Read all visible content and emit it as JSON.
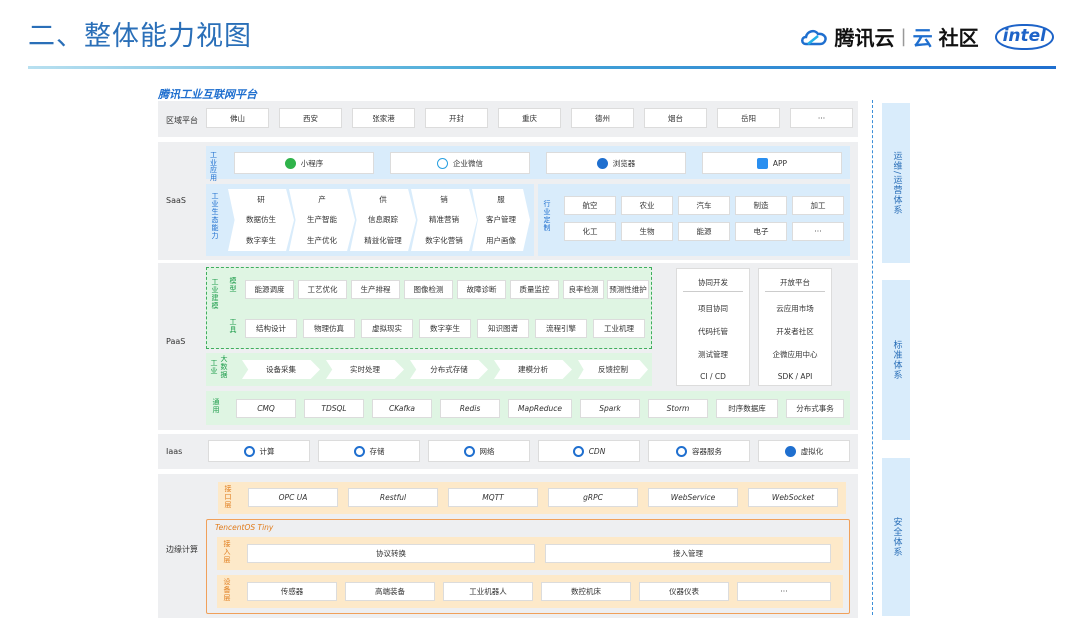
{
  "header": {
    "title": "二、整体能力视图",
    "brand_name": "腾讯云",
    "brand_sep": "|",
    "brand_yun": "云",
    "brand_community": "社区",
    "intel": "intel"
  },
  "platform_title": "腾讯工业互联网平台",
  "region": {
    "label": "区域平台",
    "items": [
      "佛山",
      "西安",
      "张家港",
      "开封",
      "重庆",
      "德州",
      "烟台",
      "岳阳",
      "···"
    ]
  },
  "saas": {
    "label": "SaaS",
    "app_label": "工业应用",
    "apps": [
      "小程序",
      "企业微信",
      "浏览器",
      "APP"
    ],
    "eco_label": "工业生态能力",
    "eco_cols": [
      {
        "head": "研",
        "items": [
          "数据仿生",
          "数字孪生"
        ]
      },
      {
        "head": "产",
        "items": [
          "生产智能",
          "生产优化"
        ]
      },
      {
        "head": "供",
        "items": [
          "信息跟踪",
          "精益化管理"
        ]
      },
      {
        "head": "销",
        "items": [
          "精准营销",
          "数字化营销"
        ]
      },
      {
        "head": "服",
        "items": [
          "客户管理",
          "用户画像"
        ]
      }
    ],
    "industry_label": "行业定制",
    "industries": [
      "航空",
      "农业",
      "汽车",
      "制造",
      "加工",
      "化工",
      "生物",
      "能源",
      "电子",
      "···"
    ]
  },
  "paas": {
    "label": "PaaS",
    "modeling_label": "工业建模",
    "model_label": "模型",
    "models": [
      "能源调度",
      "工艺优化",
      "生产排程",
      "图像检测",
      "故障诊断",
      "质量监控",
      "良率检测",
      "预测性维护"
    ],
    "tool_label": "工具",
    "tools": [
      "结构设计",
      "物理仿真",
      "虚拟现实",
      "数字孪生",
      "知识图谱",
      "流程引擎",
      "工业机理"
    ],
    "bigdata_label1": "工业",
    "bigdata_label2": "大数据",
    "bigdata": [
      "设备采集",
      "实时处理",
      "分布式存储",
      "建模分析",
      "反馈控制"
    ],
    "general_label": "通用",
    "general": [
      "CMQ",
      "TDSQL",
      "CKafka",
      "Redis",
      "MapReduce",
      "Spark",
      "Storm",
      "时序数据库",
      "分布式事务"
    ],
    "collab": {
      "head": "协同开发",
      "items": [
        "项目协同",
        "代码托管",
        "测试管理",
        "CI / CD"
      ]
    },
    "open": {
      "head": "开放平台",
      "items": [
        "云应用市场",
        "开发者社区",
        "企微应用中心",
        "SDK / API"
      ]
    }
  },
  "iaas": {
    "label": "Iaas",
    "items": [
      "计算",
      "存储",
      "网络",
      "CDN",
      "容器服务",
      "虚拟化"
    ]
  },
  "edge": {
    "label": "边缘计算",
    "interface_label": "接口层",
    "interfaces": [
      "OPC UA",
      "Restful",
      "MQTT",
      "gRPC",
      "WebService",
      "WebSocket"
    ],
    "tiny_label": "TencentOS Tiny",
    "access_label": "接入层",
    "access": [
      "协议转换",
      "接入管理"
    ],
    "device_label": "设备层",
    "devices": [
      "传感器",
      "高端装备",
      "工业机器人",
      "数控机床",
      "仪器仪表",
      "···"
    ]
  },
  "side": [
    "运维/运营体系",
    "标准体系",
    "安全体系"
  ]
}
